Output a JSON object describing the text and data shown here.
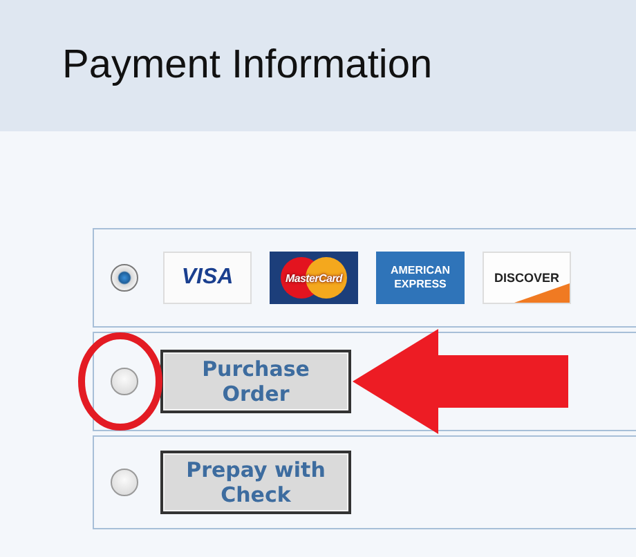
{
  "header": {
    "title": "Payment Information"
  },
  "options": [
    {
      "kind": "cards",
      "selected": true,
      "highlighted": false,
      "cards": [
        {
          "kind": "visa",
          "label": "VISA"
        },
        {
          "kind": "mastercard",
          "label": "MasterCard"
        },
        {
          "kind": "amex",
          "label": "AMERICAN EXPRESS"
        },
        {
          "kind": "discover",
          "label": "DISCOVER"
        }
      ]
    },
    {
      "kind": "button",
      "selected": false,
      "highlighted": true,
      "label": "Purchase Order"
    },
    {
      "kind": "button",
      "selected": false,
      "highlighted": false,
      "label": "Prepay with Check"
    }
  ]
}
